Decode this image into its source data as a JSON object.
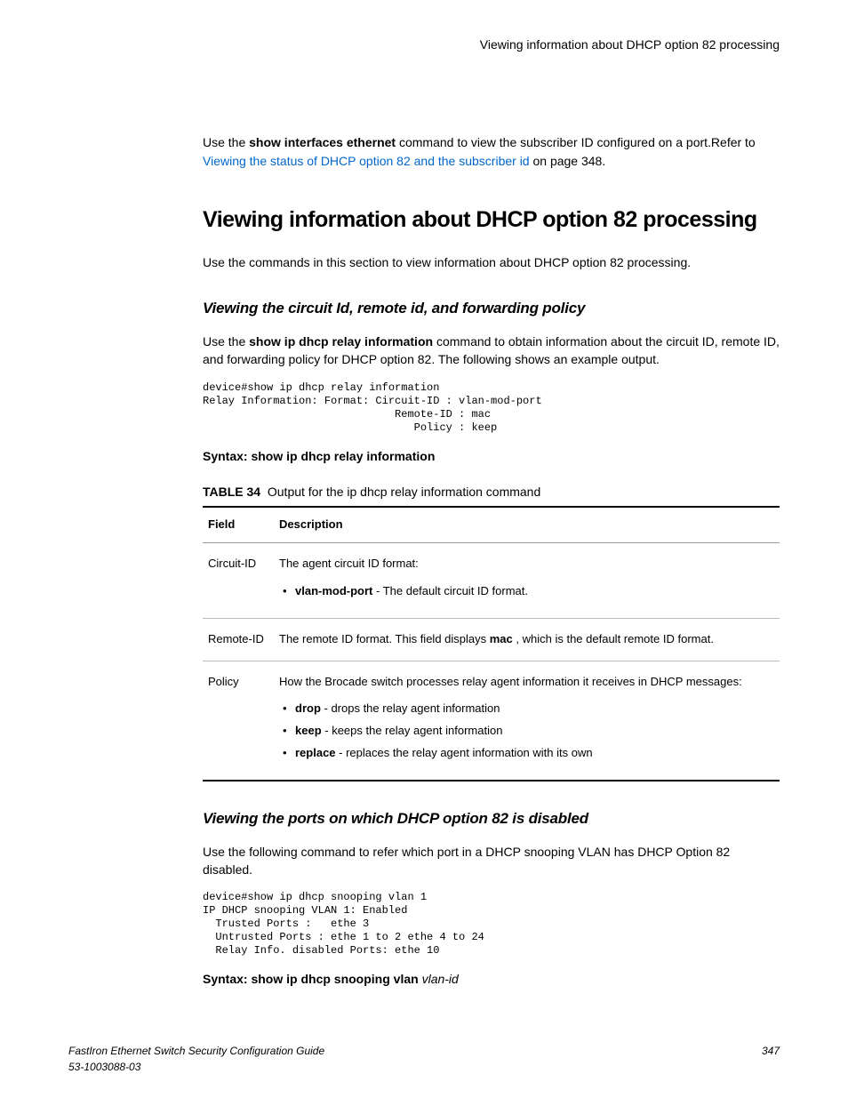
{
  "header": {
    "running_title": "Viewing information about DHCP option 82 processing"
  },
  "intro": {
    "p1_a": "Use the ",
    "p1_cmd": "show interfaces ethernet",
    "p1_b": " command to view the subscriber ID configured on a port.Refer to ",
    "p1_link": "Viewing the status of DHCP option 82 and the subscriber id",
    "p1_c": " on page 348."
  },
  "h1": "Viewing information about DHCP option 82 processing",
  "h1_para": "Use the commands in this section to view information about DHCP option 82 processing.",
  "sec1": {
    "h2": "Viewing the circuit Id, remote id, and forwarding policy",
    "p_a": "Use the ",
    "p_cmd": "show ip dhcp relay information",
    "p_b": " command to obtain information about the circuit ID, remote ID, and forwarding policy for DHCP option 82. The following shows an example output.",
    "code": "device#show ip dhcp relay information\nRelay Information: Format: Circuit-ID : vlan-mod-port\n                              Remote-ID : mac\n                                 Policy : keep",
    "syntax_bold": "Syntax: show ip dhcp relay information",
    "table_caption_label": "TABLE 34",
    "table_caption_text": "Output for the ip dhcp relay information command",
    "thead": {
      "c1": "Field",
      "c2": "Description"
    },
    "rows": [
      {
        "field": "Circuit-ID",
        "desc_lead": "The agent circuit ID format:",
        "items": [
          {
            "bold": "vlan-mod-port",
            "rest": " - The default circuit ID format."
          }
        ]
      },
      {
        "field": "Remote-ID",
        "desc_a": "The remote ID format. This field displays ",
        "desc_bold": "mac",
        "desc_b": " , which is the default remote ID format."
      },
      {
        "field": "Policy",
        "desc_lead": "How the Brocade switch processes relay agent information it receives in DHCP messages:",
        "items": [
          {
            "bold": "drop",
            "rest": " - drops the relay agent information"
          },
          {
            "bold": "keep",
            "rest": " - keeps the relay agent information"
          },
          {
            "bold": "replace",
            "rest": " - replaces the relay agent information with its own"
          }
        ]
      }
    ]
  },
  "sec2": {
    "h2": "Viewing the ports on which DHCP option 82 is disabled",
    "para": "Use the following command to refer which port in a DHCP snooping VLAN has DHCP Option 82 disabled.",
    "code": "device#show ip dhcp snooping vlan 1\nIP DHCP snooping VLAN 1: Enabled\n  Trusted Ports :   ethe 3\n  Untrusted Ports : ethe 1 to 2 ethe 4 to 24\n  Relay Info. disabled Ports: ethe 10",
    "syntax_bold": "Syntax: show ip dhcp snooping vlan ",
    "syntax_italic": "vlan-id"
  },
  "footer": {
    "title": "FastIron Ethernet Switch Security Configuration Guide",
    "docnum": "53-1003088-03",
    "pagenum": "347"
  }
}
